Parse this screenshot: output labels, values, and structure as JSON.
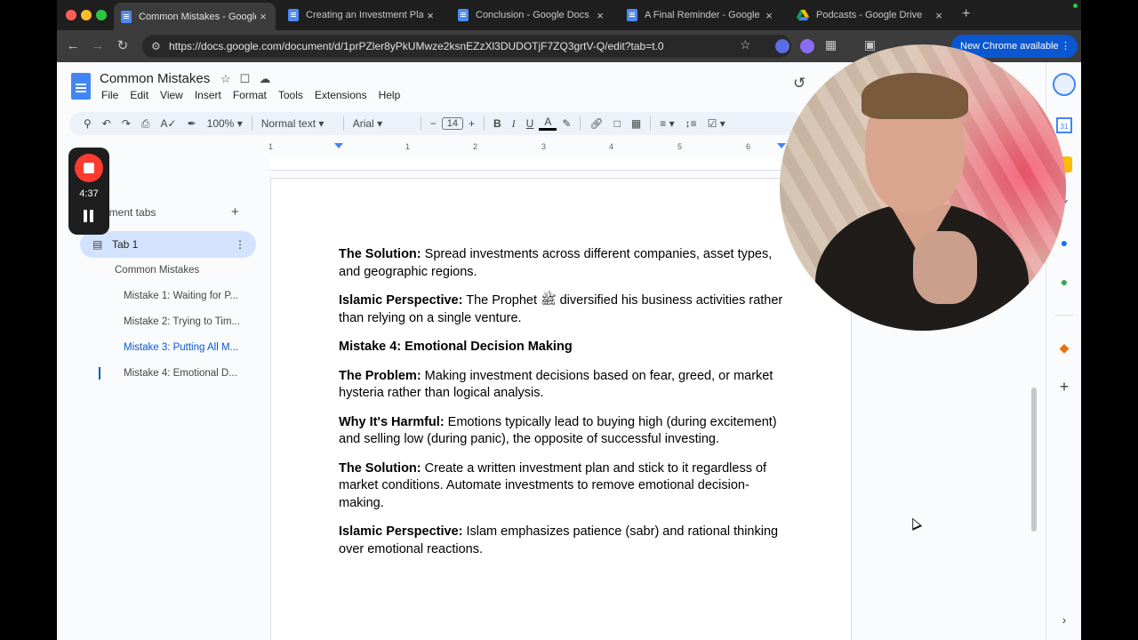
{
  "browser": {
    "tabs": [
      {
        "title": "Common Mistakes - Google Docs",
        "active": true
      },
      {
        "title": "Creating an Investment Plan - Goo",
        "active": false
      },
      {
        "title": "Conclusion - Google Docs",
        "active": false
      },
      {
        "title": "A Final Reminder - Google Docs",
        "active": false
      },
      {
        "title": "Podcasts - Google Drive",
        "active": false
      }
    ],
    "close_glyph": "×",
    "new_tab_glyph": "+",
    "url": "https://docs.google.com/document/d/1prPZler8yPkUMwze2ksnEZzXl3DUDOTjF7ZQ3grtV-Q/edit?tab=t.0",
    "update_button": "New Chrome available"
  },
  "docs": {
    "title": "Common Mistakes",
    "menu": [
      "File",
      "Edit",
      "View",
      "Insert",
      "Format",
      "Tools",
      "Extensions",
      "Help"
    ],
    "toolbar": {
      "zoom": "100%",
      "style": "Normal text",
      "font": "Arial",
      "font_size": "14"
    },
    "ruler_ticks": [
      "1",
      "1",
      "2",
      "3",
      "4",
      "5",
      "6"
    ]
  },
  "recorder": {
    "time": "4:37"
  },
  "outline": {
    "header": "ument tabs",
    "tab_name": "Tab 1",
    "items": [
      {
        "label": "Common Mistakes",
        "level": 1,
        "current": false
      },
      {
        "label": "Mistake 1: Waiting for P...",
        "level": 2,
        "current": false
      },
      {
        "label": "Mistake 2: Trying to Tim...",
        "level": 2,
        "current": false
      },
      {
        "label": "Mistake 3: Putting All M...",
        "level": 2,
        "current": true
      },
      {
        "label": "Mistake 4: Emotional D...",
        "level": 2,
        "current": false
      }
    ]
  },
  "document": {
    "paragraphs": [
      {
        "bold": "The Solution:",
        "text": " Spread investments across different companies, asset types, and geographic regions."
      },
      {
        "bold": "Islamic Perspective:",
        "text": " The Prophet ﷺ diversified his business activities rather than relying on a single venture."
      },
      {
        "bold": "Mistake 4: Emotional Decision Making",
        "text": ""
      },
      {
        "bold": "The Problem:",
        "text": " Making investment decisions based on fear, greed, or market hysteria rather than logical analysis."
      },
      {
        "bold": "Why It's Harmful:",
        "text": " Emotions typically lead to buying high (during excitement) and selling low (during panic), the opposite of successful investing."
      },
      {
        "bold": "The Solution:",
        "text": " Create a written investment plan and stick to it regardless of market conditions. Automate investments to remove emotional decision-making."
      },
      {
        "bold": "Islamic Perspective:",
        "text": " Islam emphasizes patience (sabr) and rational thinking over emotional reactions."
      }
    ]
  },
  "icons": {
    "back": "arrow-left",
    "forward": "arrow-right",
    "reload": "reload",
    "star": "star",
    "folder": "folder",
    "cloud": "cloud",
    "history": "history",
    "search": "search",
    "undo": "undo",
    "redo": "redo",
    "print": "print",
    "spellcheck": "spellcheck",
    "paint_format": "paint-format"
  },
  "colors": {
    "accent": "#0b57d0",
    "docs_blue": "#4285f4",
    "outline_selected_bg": "#d3e3fd",
    "record_red": "#ff3b30"
  }
}
